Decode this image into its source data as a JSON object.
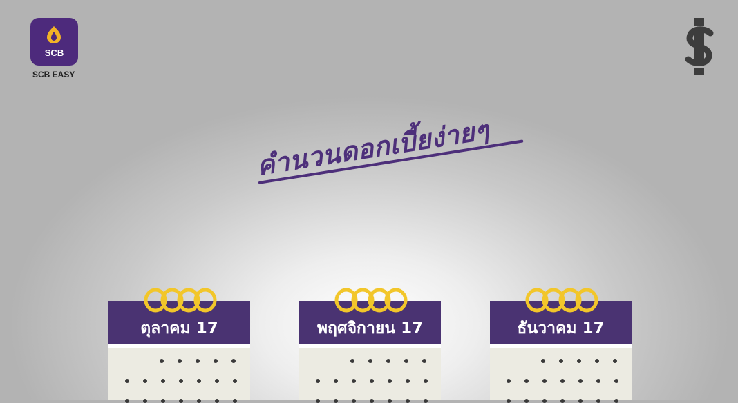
{
  "logo": {
    "text": "SCB",
    "label": "SCB EASY",
    "color": "#4d2a7c"
  },
  "brand_icon": {
    "name": "dollar-sign-icon"
  },
  "headline": {
    "text": "คำนวนดอกเบี้ยง่ายๆ",
    "color": "#4d2f7a"
  },
  "calendars": [
    {
      "month": "ตุลาคม 17"
    },
    {
      "month": "พฤศจิกายน 17"
    },
    {
      "month": "ธันวาคม 17"
    }
  ],
  "colors": {
    "calendar_header": "#4a3372",
    "calendar_body": "#ecebe2",
    "rings": "#f2c62a"
  }
}
